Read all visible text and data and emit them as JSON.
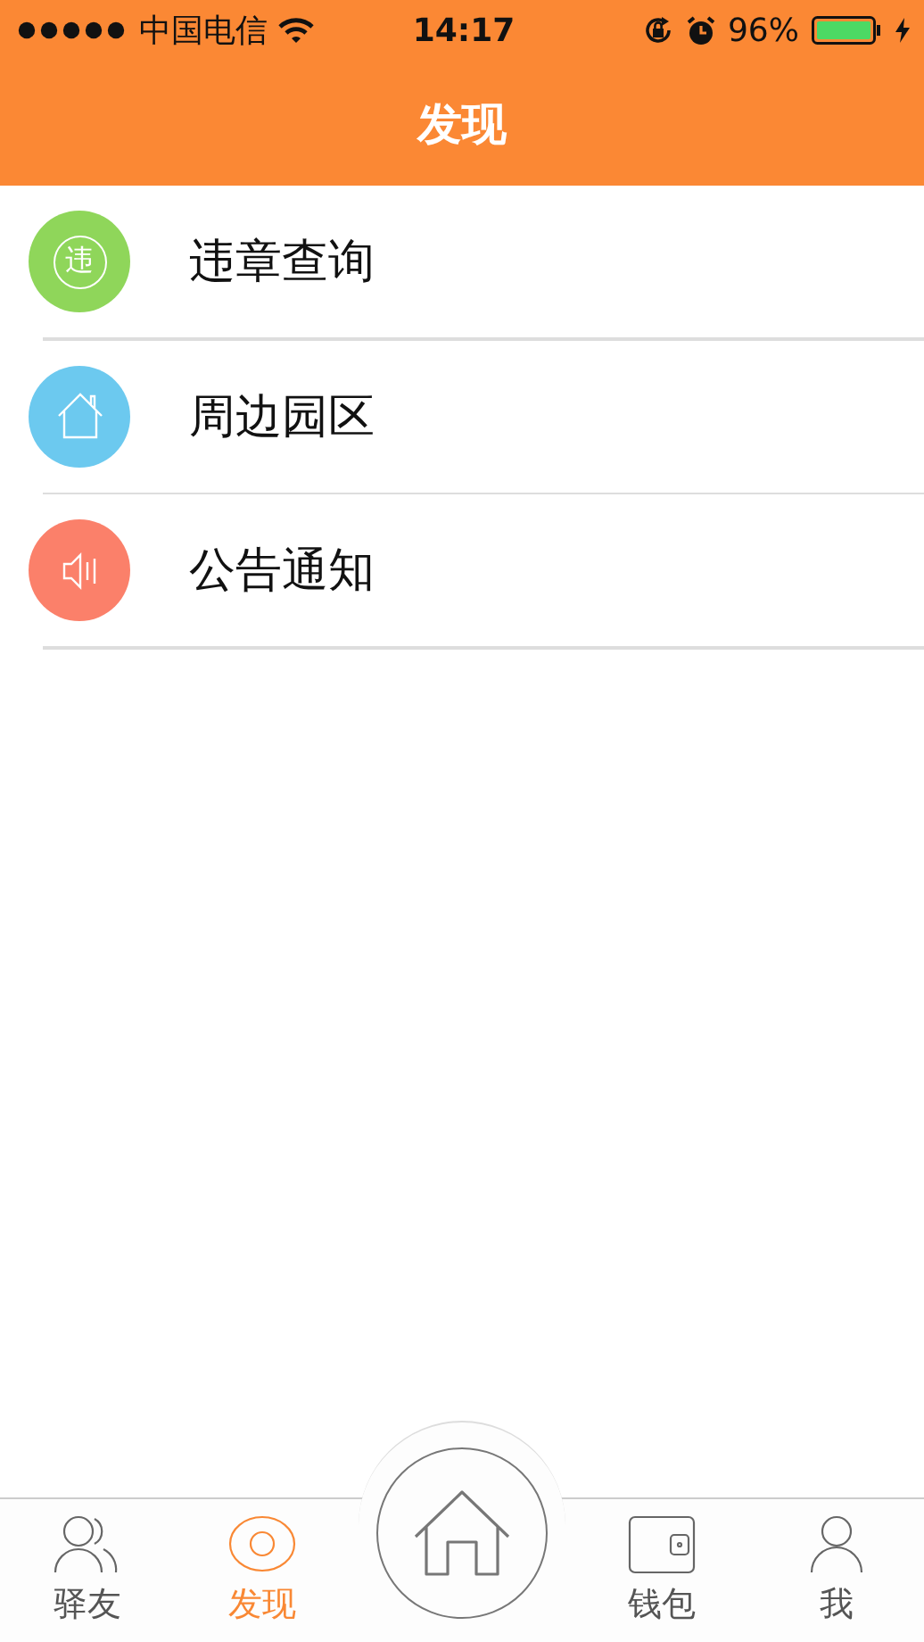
{
  "status_bar": {
    "carrier": "中国电信",
    "time": "14:17",
    "battery": "96%"
  },
  "nav_bar": {
    "title": "发现"
  },
  "items": [
    {
      "label": "违章查询",
      "kind": "violation",
      "icon_text": "违",
      "color": "#8fd65a"
    },
    {
      "label": "周边园区",
      "kind": "house",
      "color": "#6cc9ef"
    },
    {
      "label": "公告通知",
      "kind": "speaker",
      "color": "#fb806a"
    }
  ],
  "tab_bar": [
    {
      "label": "驿友",
      "kind": "friends",
      "selected": false
    },
    {
      "label": "发现",
      "kind": "discover",
      "selected": true
    },
    {
      "kind": "home",
      "selected": false
    },
    {
      "label": "钱包",
      "kind": "wallet",
      "selected": false
    },
    {
      "label": "我",
      "kind": "me",
      "selected": false
    }
  ]
}
